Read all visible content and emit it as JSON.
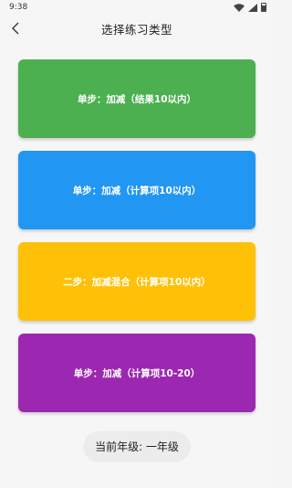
{
  "status_bar": {
    "time": "9:38"
  },
  "app_bar": {
    "title": "选择练习类型",
    "back_icon": "chevron-left-icon"
  },
  "cards": [
    {
      "label": "单步：加减（结果10以内）",
      "color": "#4caf50"
    },
    {
      "label": "单步：加减（计算项10以内）",
      "color": "#2196f3"
    },
    {
      "label": "二步：加减混合（计算项10以内）",
      "color": "#ffc107"
    },
    {
      "label": "单步：加减（计算项10-20）",
      "color": "#9c27b0"
    }
  ],
  "grade": {
    "label": "当前年级: 一年级"
  }
}
